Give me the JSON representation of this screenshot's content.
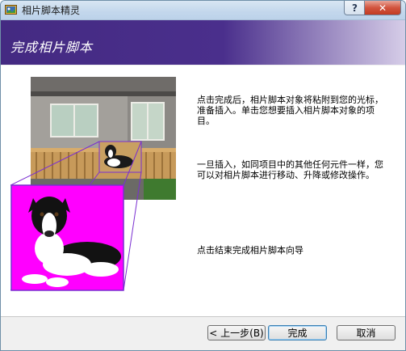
{
  "window": {
    "title": "相片脚本精灵",
    "help_label": "?",
    "close_label": "✕"
  },
  "header": {
    "title": "完成相片脚本"
  },
  "content": {
    "paragraph1": "点击完成后，相片脚本对象将粘附到您的光标，准备插入。单击您想要插入相片脚本对象的项目。",
    "paragraph2": "一旦插入，如同项目中的其他任何元件一样，您可以对相片脚本进行移动、升降或修改操作。",
    "paragraph3": "点击结束完成相片脚本向导"
  },
  "buttons": {
    "back": "< 上一步(B)",
    "finish": "完成",
    "cancel": "取消"
  },
  "colors": {
    "header_start": "#442a82",
    "magenta_background": "#ff00ff",
    "close_red": "#c23a22"
  },
  "icons": {
    "app": "photo-script-app-icon",
    "illustration": "deck-and-dog-illustration"
  }
}
